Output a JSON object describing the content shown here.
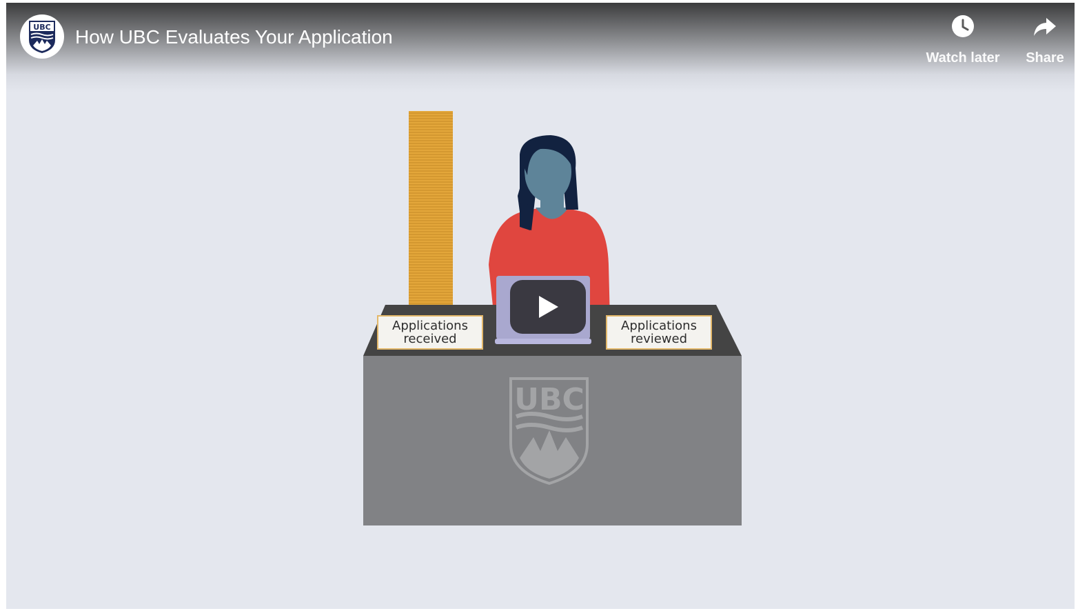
{
  "header": {
    "title": "How UBC Evaluates Your Application",
    "channel_logo_text": "UBC"
  },
  "actions": {
    "watch_later_label": "Watch later",
    "share_label": "Share"
  },
  "scene": {
    "received_label_line1": "Applications",
    "received_label_line2": "received",
    "reviewed_label_line1": "Applications",
    "reviewed_label_line2": "reviewed",
    "desk_logo_text": "UBC"
  },
  "colors": {
    "background": "#e4e7ee",
    "paper_stack": "#e3a63a",
    "sweater": "#e0463f",
    "hair": "#122240",
    "face": "#5e8499",
    "desk_top": "#444444",
    "desk_front": "#818285",
    "laptop": "#a9a8cf",
    "play_button_bg": "#212121"
  },
  "icons": {
    "watch_later": "clock-icon",
    "share": "share-arrow-icon",
    "play": "play-icon",
    "channel": "ubc-crest-icon"
  }
}
